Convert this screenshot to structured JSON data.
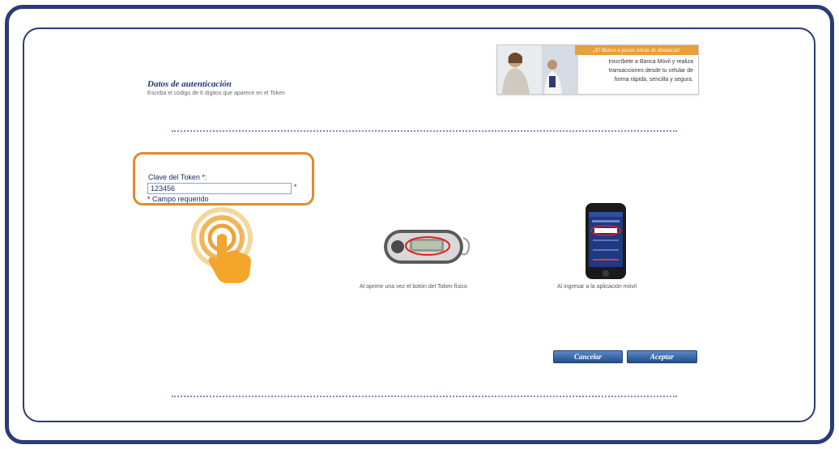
{
  "auth": {
    "title": "Datos de autenticación",
    "subtitle": "Escriba el código de 6 dígitos que aparece en el Token"
  },
  "banner": {
    "headline": "¡El Banco a pocas letras de distancia!",
    "line1": "Inscríbete a Banca Móvil y realiza",
    "line2": "transacciones desde tu celular de",
    "line3": "forma rápida, sencilla y segura."
  },
  "form": {
    "token_label": "Clave del Token *:",
    "token_value": "123456",
    "required_star": "*",
    "required_note": "* Campo requerido"
  },
  "captions": {
    "physical_token": "Al oprimir una vez el botón del Token físico",
    "mobile_app": "Al ingresar a la aplicación móvil"
  },
  "buttons": {
    "cancel": "Cancelar",
    "accept": "Aceptar"
  },
  "colors": {
    "frame": "#2c3a78",
    "highlight": "#e08a2c",
    "button": "#2f5c9c",
    "banner_accent": "#e6a039"
  }
}
